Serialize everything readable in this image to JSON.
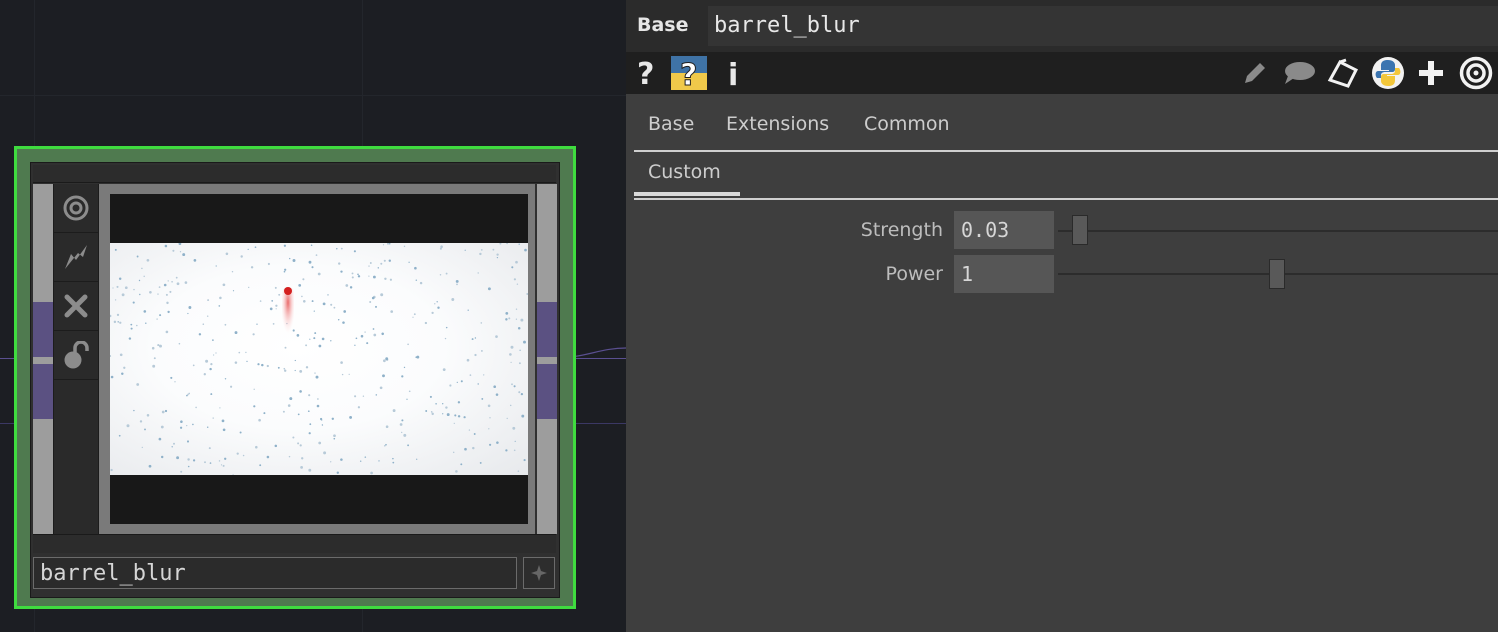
{
  "network": {
    "node": {
      "name": "barrel_blur"
    }
  },
  "param_panel": {
    "op_type": "Base",
    "op_name": "barrel_blur",
    "toolbar": {
      "help_icon": "question-mark-icon",
      "python_help_icon": "python-help-icon",
      "info_icon": "info-icon",
      "edit_icon": "pencil-icon",
      "comment_icon": "comment-icon",
      "clone_icon": "clipboard-icon",
      "python_icon": "python-icon",
      "add_icon": "plus-icon",
      "viewer_icon": "target-icon"
    },
    "tabs_row1": [
      "Base",
      "Extensions",
      "Common"
    ],
    "tabs_row2": [
      "Custom"
    ],
    "active_tab": "Custom",
    "params": [
      {
        "label": "Strength",
        "value": "0.03",
        "slider_fraction": 0.03
      },
      {
        "label": "Power",
        "value": "1",
        "slider_fraction": 0.5
      }
    ]
  },
  "colors": {
    "node_selected_outline": "#3fdc3f",
    "connector_highlight": "#5b5182",
    "wire": "#5a4f90"
  }
}
